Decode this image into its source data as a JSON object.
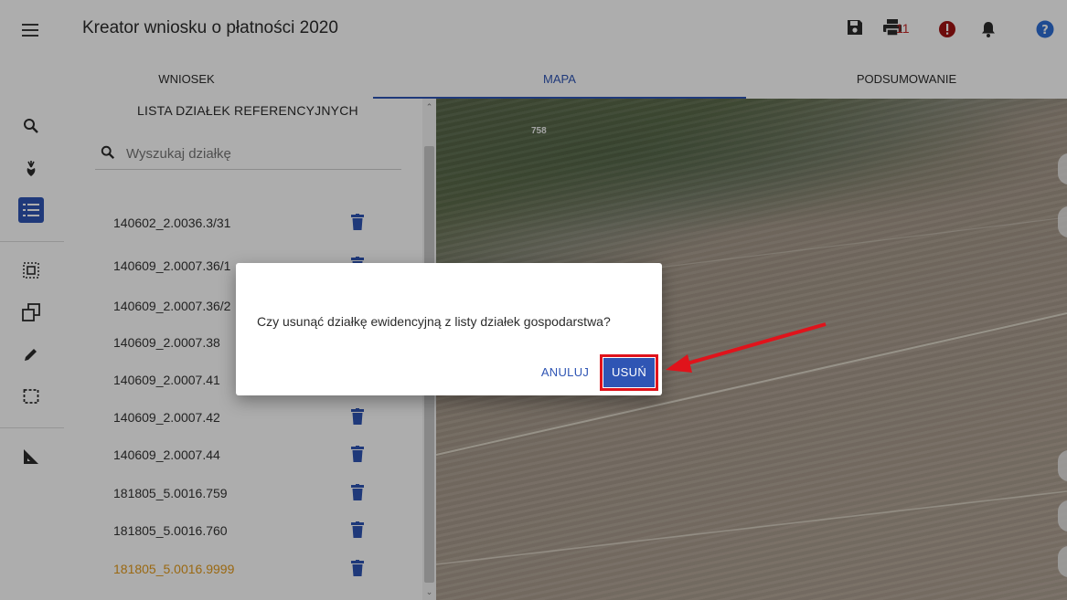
{
  "header": {
    "title": "Kreator wniosku o płatności 2020",
    "alert_count": "11"
  },
  "tabs": [
    {
      "label": "WNIOSEK"
    },
    {
      "label": "MAPA"
    },
    {
      "label": "PODSUMOWANIE"
    }
  ],
  "active_tab": "MAPA",
  "tools": [
    "search-icon",
    "crop-icon",
    "list-icon",
    "select-area-icon",
    "copy-icon",
    "pencil-icon",
    "dashed-rectangle-icon",
    "measure-icon"
  ],
  "list_panel": {
    "title": "LISTA DZIAŁEK REFERENCYJNYCH",
    "search_placeholder": "Wyszukaj działkę",
    "items": [
      {
        "label": "140602_2.0036.3/31"
      },
      {
        "label": "140609_2.0007.36/1"
      },
      {
        "label": "140609_2.0007.36/2"
      },
      {
        "label": "140609_2.0007.38"
      },
      {
        "label": "140609_2.0007.41"
      },
      {
        "label": "140609_2.0007.42"
      },
      {
        "label": "140609_2.0007.44"
      },
      {
        "label": "181805_5.0016.759"
      },
      {
        "label": "181805_5.0016.760"
      },
      {
        "label": "181805_5.0016.9999"
      }
    ],
    "highlighted_item_color": "#e39a1a"
  },
  "map": {
    "parcel_label": "758"
  },
  "dialog": {
    "message": "Czy usunąć działkę ewidencyjną z listy działek gospodarstwa?",
    "cancel_label": "ANULUJ",
    "confirm_label": "USUŃ"
  },
  "colors": {
    "accent": "#2f55b4",
    "annotation": "#e0131b",
    "alert": "#c62828"
  }
}
